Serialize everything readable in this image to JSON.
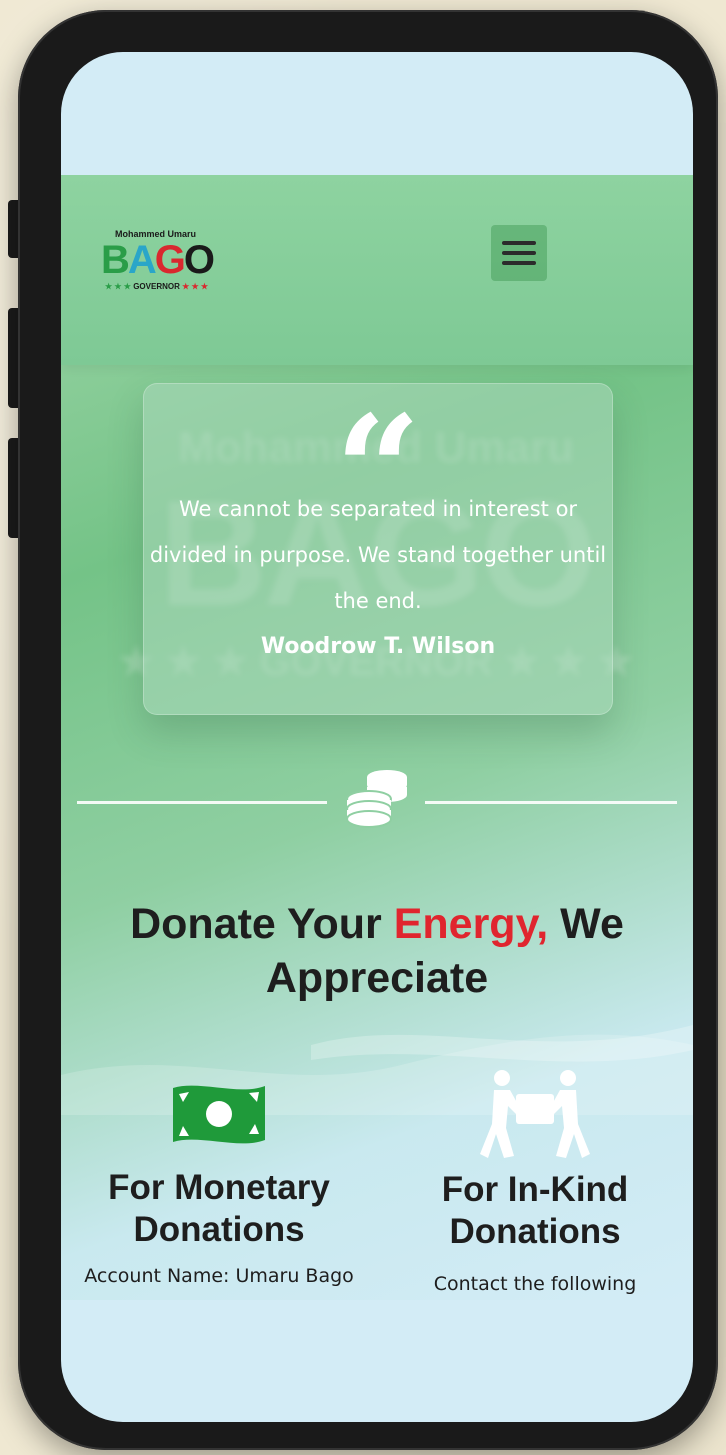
{
  "header": {
    "logo": {
      "top_text": "Mohammed Umaru",
      "name_letters": [
        "B",
        "A",
        "G",
        "O"
      ],
      "subtitle": "GOVERNOR",
      "stars": "★ ★ ★"
    },
    "menu_icon": "hamburger-icon"
  },
  "hero": {
    "quote_mark": "“",
    "quote": "We cannot be separated in interest or divided in purpose. We stand together until the end.",
    "author": "Woodrow T. Wilson"
  },
  "divider_icon": "coins-icon",
  "donate": {
    "title_start": "Donate Your ",
    "title_accent": "Energy,",
    "title_end": " We Appreciate"
  },
  "columns": [
    {
      "icon": "money-bill-icon",
      "title": "For Monetary Donations",
      "text": "Account Name: Umaru Bago"
    },
    {
      "icon": "people-carry-icon",
      "title": "For In-Kind Donations",
      "text": "Contact the following"
    }
  ],
  "colors": {
    "accent_red": "#e0252e",
    "brand_green": "#2a9d48",
    "money_green": "#1f9a3a"
  }
}
